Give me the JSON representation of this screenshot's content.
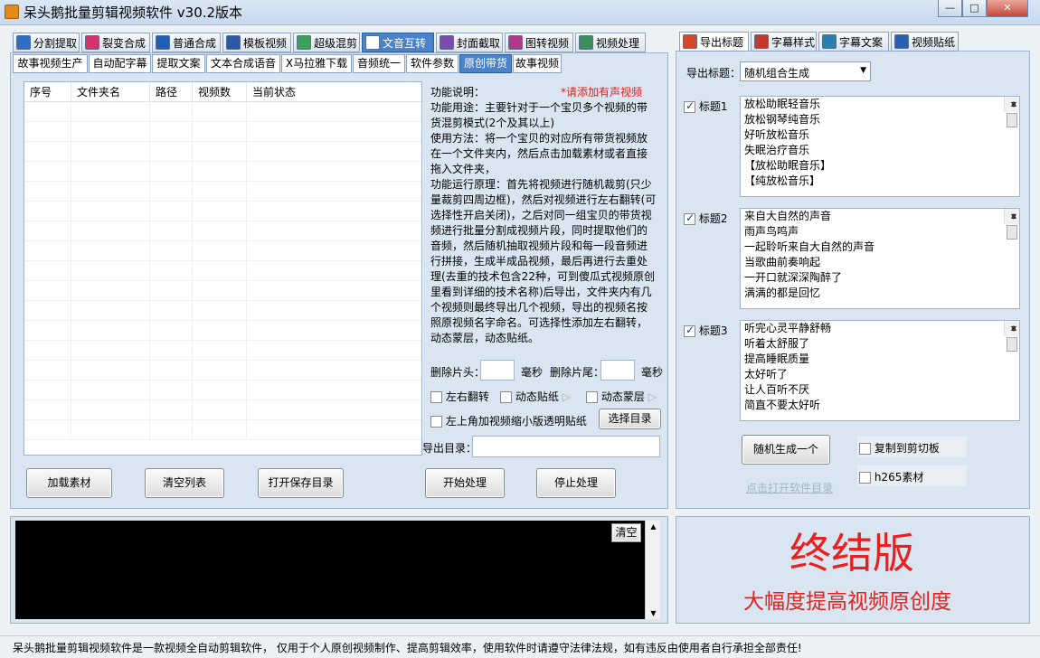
{
  "window": {
    "title": "呆头鹅批量剪辑视频软件   v30.2版本",
    "minimize": "—",
    "maximize": "□",
    "close": "✕"
  },
  "main_tabs": [
    {
      "label": "分割提取",
      "icon": "split-icon",
      "color": "#2e6fc4"
    },
    {
      "label": "裂变合成",
      "icon": "fission-icon",
      "color": "#d6336c"
    },
    {
      "label": "普通合成",
      "icon": "play-icon",
      "color": "#1f5fb5"
    },
    {
      "label": "模板视频",
      "icon": "template-icon",
      "color": "#2b59a8"
    },
    {
      "label": "超级混剪",
      "icon": "audio-bars-icon",
      "color": "#3aa35a"
    },
    {
      "label": "文音互转",
      "icon": "mic-icon",
      "color": "#ffffff"
    },
    {
      "label": "封面截取",
      "icon": "image-icon",
      "color": "#7a4bb0"
    },
    {
      "label": "图转视频",
      "icon": "picture-video-icon",
      "color": "#b03a8a"
    },
    {
      "label": "视频处理",
      "icon": "video-process-icon",
      "color": "#3a8f5a"
    }
  ],
  "sub_tabs": [
    "故事视频生产",
    "自动配字幕",
    "提取文案",
    "文本合成语音",
    "X马拉雅下载",
    "音频统一",
    "软件参数",
    "原创带货",
    "故事视频"
  ],
  "table": {
    "headers": [
      "序号",
      "文件夹名",
      "路径",
      "视频数",
      "当前状态"
    ]
  },
  "description": {
    "heading": "功能说明：",
    "warning": "*请添加有声视频",
    "lines": [
      "功能用途：主要针对于一个宝贝多个视频的带",
      "货混剪模式(2个及其以上)",
      "使用方法：将一个宝贝的对应所有带货视频放",
      "在一个文件夹内，然后点击加载素材或者直接",
      "拖入文件夹，",
      "功能运行原理：首先将视频进行随机裁剪(只少",
      "量裁剪四周边框)，然后对视频进行左右翻转(可",
      "选择性开启关闭)，之后对同一组宝贝的带货视",
      "频进行批量分割成视频片段，同时提取他们的",
      "音频，然后随机抽取视频片段和每一段音频进",
      "行拼接，生成半成品视频，最后再进行去重处",
      "理(去重的技术包含22种，可到傻瓜式视频原创",
      "里看到详细的技术名称)后导出，文件夹内有几",
      "个视频则最终导出几个视频，导出的视频名按",
      "照原视频名字命名。可选择性添加左右翻转，",
      "动态蒙层，动态贴纸。"
    ]
  },
  "options": {
    "trim_head_label": "删除片头：",
    "trim_tail_label": "删除片尾：",
    "ms_unit": "毫秒",
    "flip_label": "左右翻转",
    "sticker_label": "动态贴纸",
    "mask_label": "动态蒙层",
    "corner_label": "左上角加视频缩小版透明贴纸",
    "select_dir_button": "选择目录",
    "export_dir_label": "导出目录："
  },
  "buttons": {
    "load": "加载素材",
    "clear_list": "清空列表",
    "open_save_dir": "打开保存目录",
    "start": "开始处理",
    "stop": "停止处理"
  },
  "log": {
    "clear_button": "清空"
  },
  "right_tabs": [
    {
      "label": "导出标题",
      "icon": "export-title-icon",
      "color": "#d34a2a"
    },
    {
      "label": "字幕样式",
      "icon": "subtitle-style-icon",
      "color": "#c0392b"
    },
    {
      "label": "字幕文案",
      "icon": "subtitle-text-icon",
      "color": "#2a7fb0"
    },
    {
      "label": "视频贴纸",
      "icon": "star-icon",
      "color": "#2a60b0"
    }
  ],
  "export": {
    "label": "导出标题：",
    "selected": "随机组合生成"
  },
  "title_groups": [
    {
      "label": "标题1",
      "checked": true,
      "items": [
        "放松助眠轻音乐",
        "放松钢琴纯音乐",
        "好听放松音乐",
        "失眠治疗音乐",
        "【放松助眠音乐】",
        "【纯放松音乐】"
      ]
    },
    {
      "label": "标题2",
      "checked": true,
      "items": [
        "来自大自然的声音",
        "雨声鸟鸣声",
        "一起聆听来自大自然的声音",
        "当歌曲前奏响起",
        "一开口就深深陶醉了",
        "满满的都是回忆"
      ]
    },
    {
      "label": "标题3",
      "checked": true,
      "items": [
        "听完心灵平静舒畅",
        "听着太舒服了",
        "提高睡眠质量",
        "太好听了",
        "让人百听不厌",
        "简直不要太好听"
      ]
    }
  ],
  "random_generate_button": "随机生成一个",
  "copy_clipboard_label": "复制到剪切板",
  "h265_label": "h265素材",
  "open_dir_link": "点击打开软件目录",
  "promo": {
    "title": "终结版",
    "subtitle": "大幅度提高视频原创度",
    "color": "#e8201f"
  },
  "status_bar": "呆头鹅批量剪辑视频软件是一款视频全自动剪辑软件， 仅用于个人原创视频制作、提高剪辑效率，使用软件时请遵守法律法规，如有违反由使用者自行承担全部责任!"
}
